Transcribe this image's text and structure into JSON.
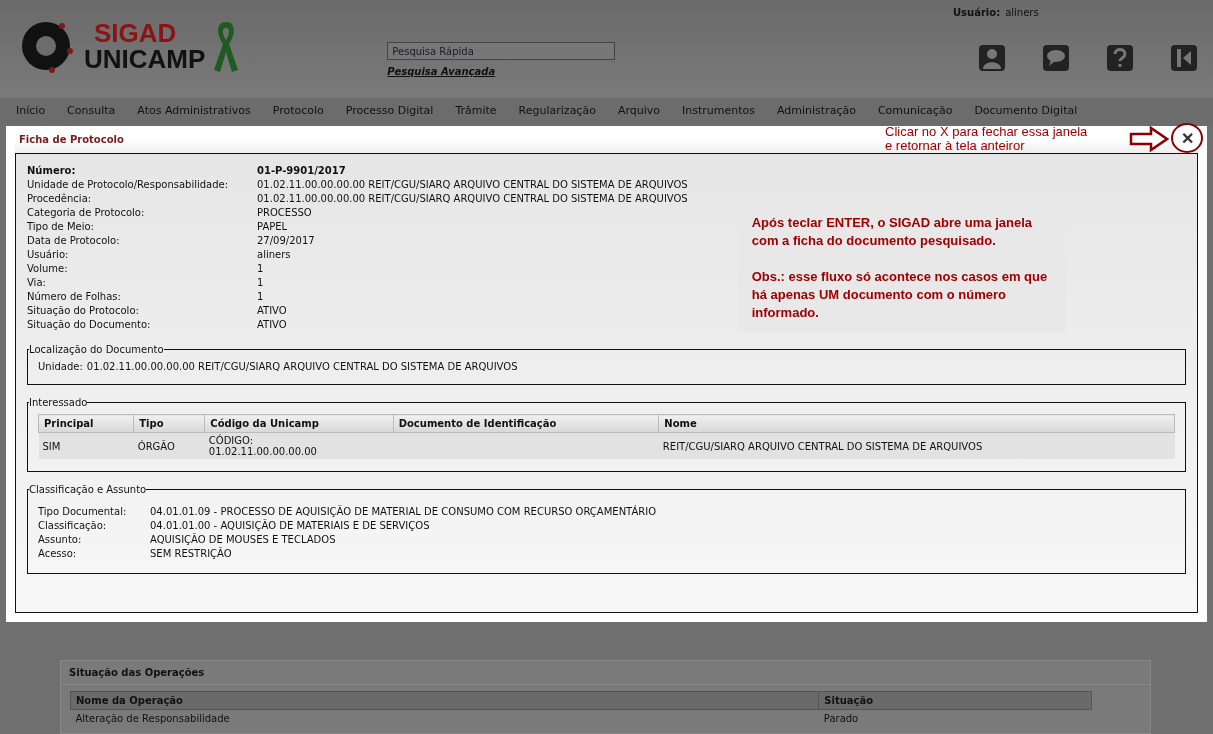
{
  "header": {
    "logo_top": "SIGAD",
    "logo_bottom": "UNICAMP",
    "search": {
      "placeholder": "Pesquisa Rápida"
    },
    "advanced_search": "Pesquisa Avançada",
    "user_label": "Usuário:",
    "user_name": "aliners"
  },
  "menu": [
    "Início",
    "Consulta",
    "Atos Administrativos",
    "Protocolo",
    "Processo Digital",
    "Trâmite",
    "Regularização",
    "Arquivo",
    "Instrumentos",
    "Administração",
    "Comunicação",
    "Documento Digital"
  ],
  "modal": {
    "title": "Ficha de Protocolo",
    "close_hint": "Clicar no X para fechar essa janela\ne retornar à tela anteiror",
    "close": "✕",
    "fields": [
      {
        "label": "Número:",
        "value": "01-P-9901/2017",
        "bold": true
      },
      {
        "label": "Unidade de Protocolo/Responsabilidade:",
        "value": "01.02.11.00.00.00.00 REIT/CGU/SIARQ ARQUIVO CENTRAL DO SISTEMA DE ARQUIVOS",
        "bold": false
      },
      {
        "label": "Procedência:",
        "value": "01.02.11.00.00.00.00 REIT/CGU/SIARQ ARQUIVO CENTRAL DO SISTEMA DE ARQUIVOS",
        "bold": false
      },
      {
        "label": "Categoria de Protocolo:",
        "value": "PROCESSO",
        "bold": false
      },
      {
        "label": "Tipo de Meio:",
        "value": "PAPEL",
        "bold": false
      },
      {
        "label": "Data de Protocolo:",
        "value": "27/09/2017",
        "bold": false
      },
      {
        "label": "Usuário:",
        "value": "aliners",
        "bold": false
      },
      {
        "label": "Volume:",
        "value": "1",
        "bold": false
      },
      {
        "label": "Via:",
        "value": "1",
        "bold": false
      },
      {
        "label": "Número de Folhas:",
        "value": "1",
        "bold": false
      },
      {
        "label": "Situação do Protocolo:",
        "value": "ATIVO",
        "bold": false
      },
      {
        "label": "Situação do Documento:",
        "value": "ATIVO",
        "bold": false
      }
    ],
    "note": [
      "Após teclar ENTER, o SIGAD abre uma janela com a ficha do documento pesquisado.",
      "Obs.: esse fluxo só acontece nos casos em que há apenas UM documento com o número informado."
    ],
    "location": {
      "legend": "Localização do Documento",
      "label": "Unidade:",
      "value": "01.02.11.00.00.00.00 REIT/CGU/SIARQ ARQUIVO CENTRAL DO SISTEMA DE ARQUIVOS"
    },
    "interested": {
      "legend": "Interessado",
      "columns": [
        "Principal",
        "Tipo",
        "Código da Unicamp",
        "Documento de Identificação",
        "Nome"
      ],
      "rows": [
        [
          "SIM",
          "ÓRGÃO",
          "CÓDIGO:\n01.02.11.00.00.00.00",
          "",
          "REIT/CGU/SIARQ ARQUIVO CENTRAL DO SISTEMA DE ARQUIVOS"
        ]
      ]
    },
    "classification": {
      "legend": "Classificação e Assunto",
      "fields": [
        {
          "label": "Tipo Documental:",
          "value": "04.01.01.09 - PROCESSO DE AQUISIÇÃO DE MATERIAL DE CONSUMO COM RECURSO ORÇAMENTÁRIO"
        },
        {
          "label": "Classificação:",
          "value": "04.01.01.00 - AQUISIÇÃO DE MATERIAIS E DE SERVIÇOS"
        },
        {
          "label": "Assunto:",
          "value": "AQUISIÇÃO DE MOUSES E TECLADOS"
        },
        {
          "label": "Acesso:",
          "value": "SEM RESTRIÇÃO"
        }
      ]
    }
  },
  "operations": {
    "title": "Situação das Operações",
    "columns": [
      "Nome da Operação",
      "Situação"
    ],
    "rows": [
      [
        "Alteração de Responsabilidade",
        "Parado"
      ]
    ]
  }
}
